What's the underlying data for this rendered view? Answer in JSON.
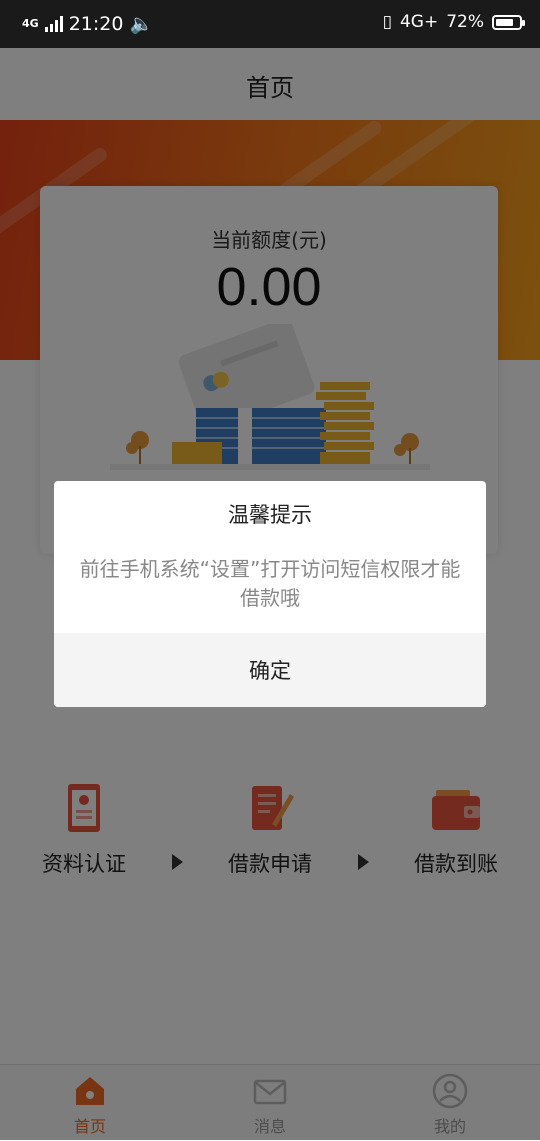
{
  "status_bar": {
    "network_type": "4G",
    "time": "21:20",
    "data_network": "4G+",
    "battery_percent": "72%",
    "battery_level": 0.72
  },
  "header": {
    "title": "首页"
  },
  "card": {
    "limit_label": "当前额度(元)",
    "limit_value": "0.00"
  },
  "steps": [
    {
      "label": "资料认证",
      "icon": "id-document-icon"
    },
    {
      "label": "借款申请",
      "icon": "application-form-icon"
    },
    {
      "label": "借款到账",
      "icon": "wallet-icon"
    }
  ],
  "tabbar": {
    "items": [
      {
        "label": "首页",
        "icon": "home-icon",
        "active": true
      },
      {
        "label": "消息",
        "icon": "mail-icon",
        "active": false
      },
      {
        "label": "我的",
        "icon": "user-icon",
        "active": false
      }
    ]
  },
  "dialog": {
    "title": "温馨提示",
    "message": "前往手机系统“设置”打开访问短信权限才能借款哦",
    "confirm_label": "确定"
  },
  "colors": {
    "accent": "#f06a25",
    "hero_start": "#e8421a",
    "hero_end": "#f8a21c",
    "overlay": "rgba(0,0,0,0.5)"
  }
}
